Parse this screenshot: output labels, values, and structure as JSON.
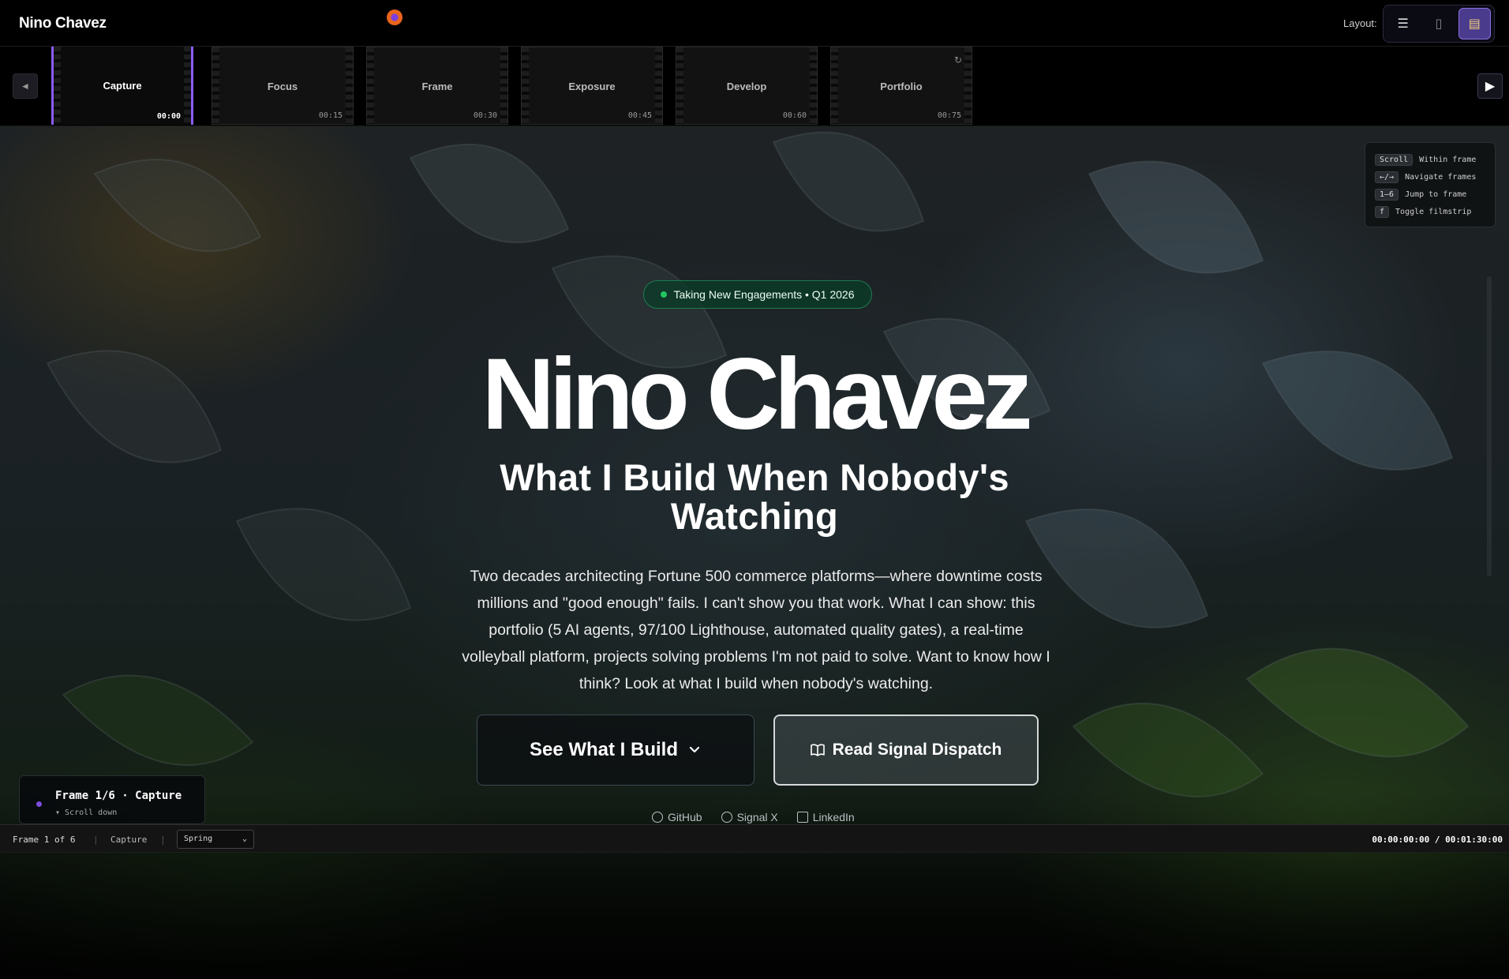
{
  "header": {
    "brand": "Nino Chavez",
    "layout_label": "Layout:",
    "layout_options": [
      {
        "icon": "list-icon",
        "glyph": "☰"
      },
      {
        "icon": "book-icon",
        "glyph": "▯"
      },
      {
        "icon": "filmstrip-icon",
        "glyph": "▤"
      }
    ]
  },
  "filmstrip": {
    "prev_glyph": "◄",
    "play_glyph": "▶",
    "frames": [
      {
        "title": "Capture",
        "time": "00:00"
      },
      {
        "title": "Focus",
        "time": "00:15"
      },
      {
        "title": "Frame",
        "time": "00:30"
      },
      {
        "title": "Exposure",
        "time": "00:45"
      },
      {
        "title": "Develop",
        "time": "00:60"
      },
      {
        "title": "Portfolio",
        "time": "00:75"
      }
    ],
    "active_index": 0
  },
  "shortcuts": [
    {
      "key": "Scroll",
      "desc": "Within frame"
    },
    {
      "key": "←/→",
      "desc": "Navigate frames"
    },
    {
      "key": "1–6",
      "desc": "Jump to frame"
    },
    {
      "key": "f",
      "desc": "Toggle filmstrip"
    }
  ],
  "hero": {
    "badge": "Taking New Engagements • Q1 2026",
    "name": "Nino Chavez",
    "subtitle": "What I Build When Nobody's Watching",
    "body": "Two decades architecting Fortune 500 commerce platforms—where downtime costs millions and \"good enough\" fails. I can't show you that work. What I can show: this portfolio (5 AI agents, 97/100 Lighthouse, automated quality gates), a real-time volleyball platform, projects solving problems I'm not paid to solve. Want to know how I think? Look at what I build when nobody's watching.",
    "primary_cta": "See What I Build",
    "secondary_cta": "Read Signal Dispatch",
    "socials": [
      "GitHub",
      "Signal X",
      "LinkedIn"
    ]
  },
  "frame_tip": {
    "title": "Frame 1/6 · Capture",
    "hint": "▾ Scroll down"
  },
  "statusbar": {
    "frame": "Frame 1 of 6",
    "name": "Capture",
    "select_value": "Spring",
    "timecode": "00:00:00:00 / 00:01:30:00"
  },
  "colors": {
    "accent": "#8a5cf6",
    "badge_green": "#22c55e",
    "background": "#000000"
  }
}
